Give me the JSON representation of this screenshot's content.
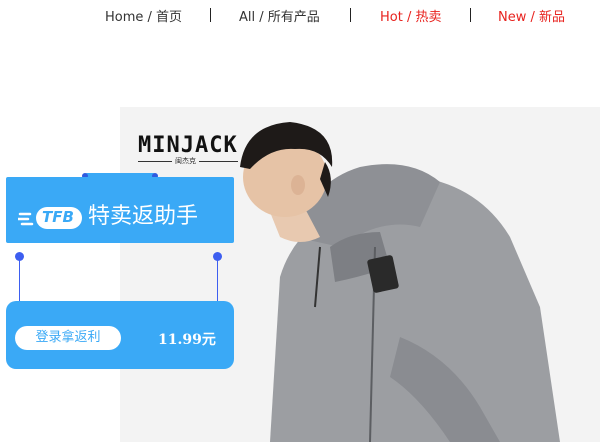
{
  "nav": {
    "items": [
      {
        "label": "Home / 首页",
        "color": "#333333"
      },
      {
        "label": "All / 所有产品",
        "color": "#333333"
      },
      {
        "label": "Hot / 热卖",
        "color": "#e8231f"
      },
      {
        "label": "New / 新品",
        "color": "#e8231f"
      }
    ]
  },
  "product": {
    "brand": "MINJACK",
    "brand_sub": "闽杰克",
    "jacket_color": "#9c9ea2"
  },
  "widget": {
    "logo_text": "TFB",
    "title": "特卖返助手",
    "login_label": "登录拿返利",
    "price": "11.99元",
    "accent_color": "#3aa9f6"
  }
}
